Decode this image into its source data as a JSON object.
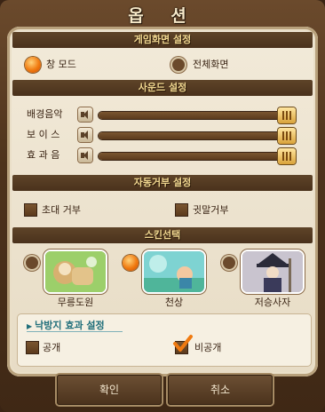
{
  "title": "옵 션",
  "sections": {
    "display": "게임화면 설정",
    "sound": "사운드 설정",
    "auto_reject": "자동거부 설정",
    "skin": "스킨선택"
  },
  "display": {
    "window_mode": "창 모드",
    "fullscreen": "전체화면",
    "selected": "창 모드"
  },
  "sound": {
    "bgm_label": "배경음악",
    "voice_label": "보 이 스",
    "effect_label": "효 과 음",
    "bgm_level": 1.0,
    "voice_level": 1.0,
    "effect_level": 1.0
  },
  "auto_reject": {
    "invite": "초대 거부",
    "whisper": "귓말거부"
  },
  "skin": {
    "options": [
      {
        "label": "무릉도원"
      },
      {
        "label": "천상"
      },
      {
        "label": "저승사자"
      }
    ],
    "selected": "천상"
  },
  "anti_addiction": {
    "header": "낙방지 효과 설정",
    "public": "공개",
    "private": "비공개",
    "selected": "비공개"
  },
  "buttons": {
    "ok": "확인",
    "cancel": "취소"
  },
  "colors": {
    "accent_orange": "#f07a10",
    "panel_bg": "#f2ead9",
    "header_bar": "#5e4428",
    "header_text": "#f0d790",
    "teal_header": "#1f6e7a"
  }
}
